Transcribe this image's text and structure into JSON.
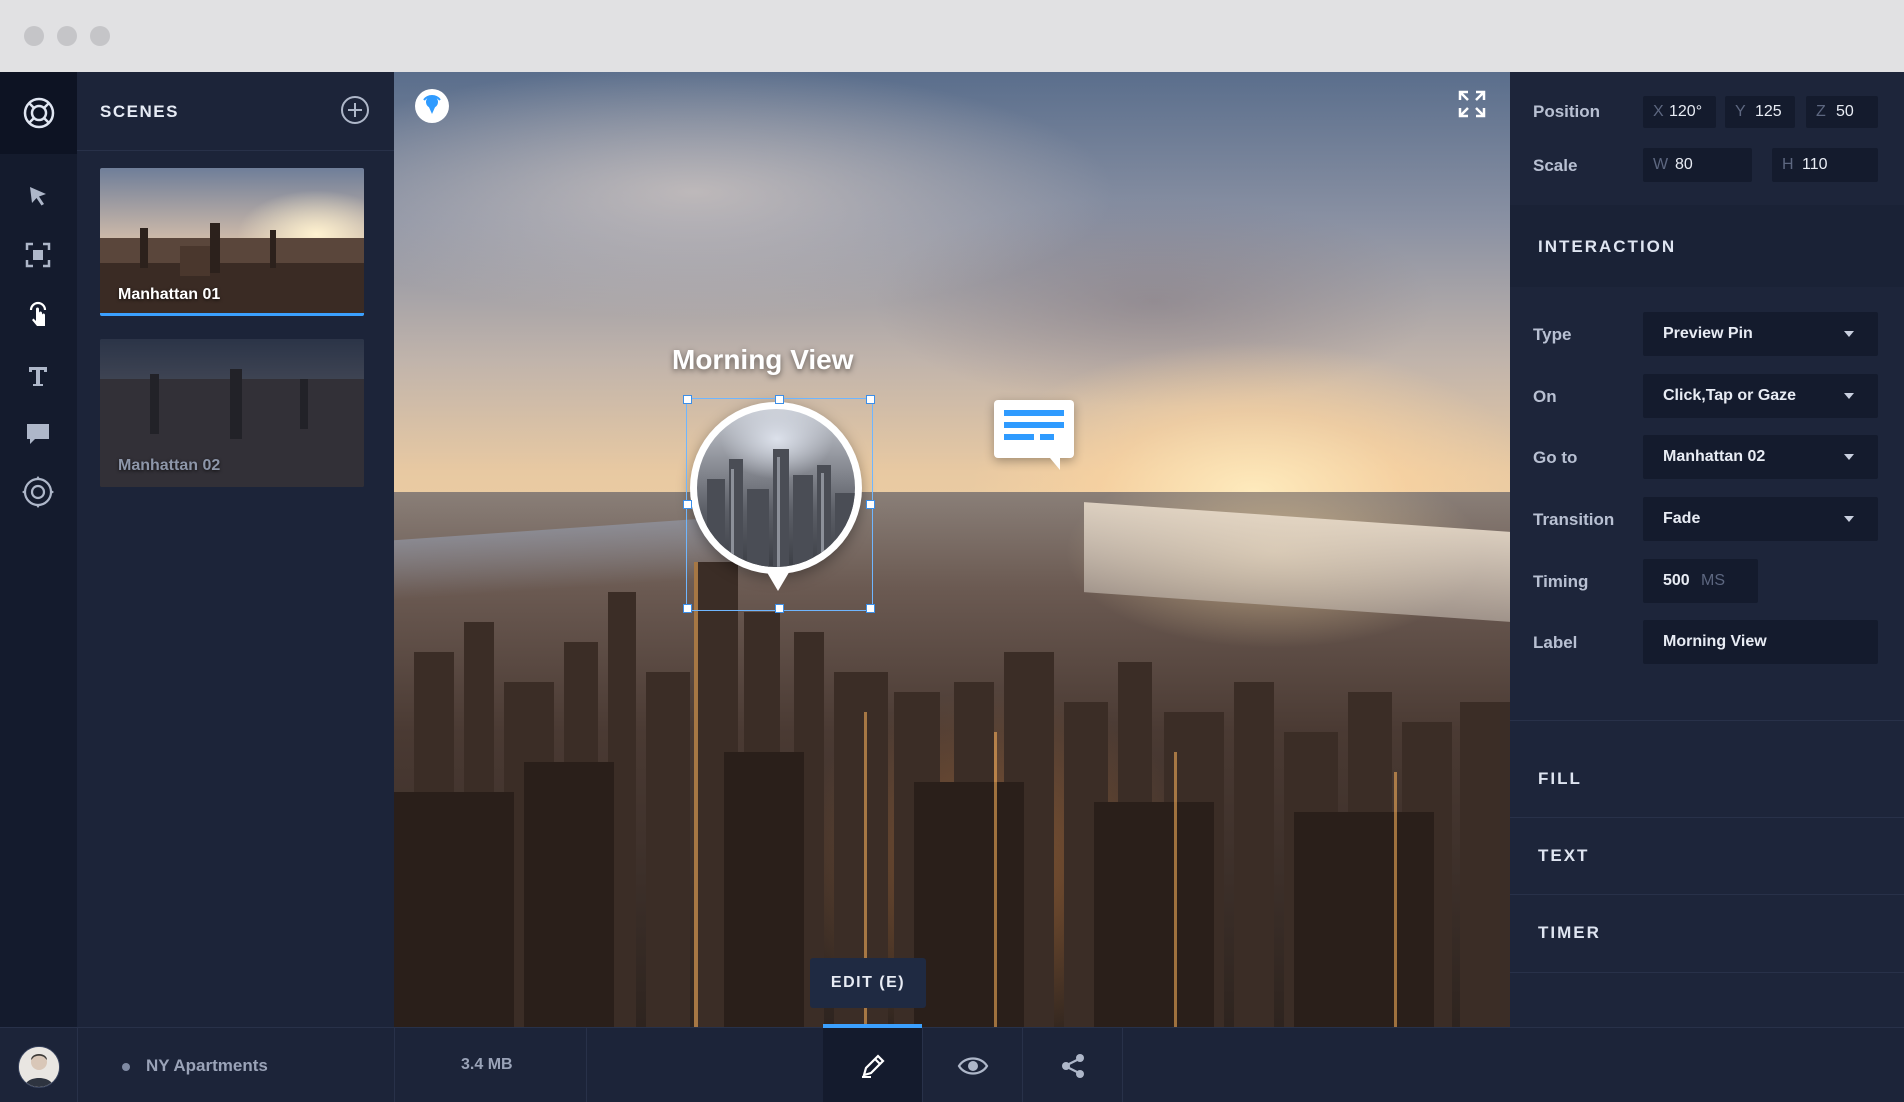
{
  "app": {
    "icons": {
      "logo": "logo-ring-icon",
      "tools": [
        "select-arrow-icon",
        "transform-icon",
        "hotspot-touch-icon",
        "text-icon",
        "comment-icon",
        "orbit-icon"
      ]
    }
  },
  "scenes": {
    "title": "SCENES",
    "add_icon": "plus-circle-icon",
    "items": [
      {
        "label": "Manhattan 01",
        "selected": true
      },
      {
        "label": "Manhattan 02",
        "selected": false
      }
    ]
  },
  "viewport": {
    "pin_label": "Morning View",
    "edit_hint": "EDIT (E)",
    "icons": [
      "compass-pin-icon",
      "fullscreen-icon",
      "chat-bubble-icon"
    ]
  },
  "properties": {
    "position": {
      "label": "Position",
      "x_axis": "X",
      "x": "120°",
      "y_axis": "Y",
      "y": "125",
      "z_axis": "Z",
      "z": "50"
    },
    "scale": {
      "label": "Scale",
      "w_axis": "W",
      "w": "80",
      "h_axis": "H",
      "h": "110"
    },
    "interaction": {
      "title": "INTERACTION",
      "type_label": "Type",
      "type_value": "Preview Pin",
      "on_label": "On",
      "on_value": "Click,Tap or Gaze",
      "goto_label": "Go to",
      "goto_value": "Manhattan 02",
      "transition_label": "Transition",
      "transition_value": "Fade",
      "timing_label": "Timing",
      "timing_value": "500",
      "timing_unit": "MS",
      "label_label": "Label",
      "label_value": "Morning View"
    },
    "sections": [
      "FILL",
      "TEXT",
      "TIMER"
    ]
  },
  "bottom": {
    "project": "NY Apartments",
    "size": "3.4 MB",
    "modes": [
      "edit-pencil-icon",
      "preview-eye-icon",
      "share-icon"
    ],
    "active_mode": "edit"
  },
  "colors": {
    "accent": "#3ba0ff",
    "panel": "#1d253a",
    "rail": "#141b2d"
  }
}
